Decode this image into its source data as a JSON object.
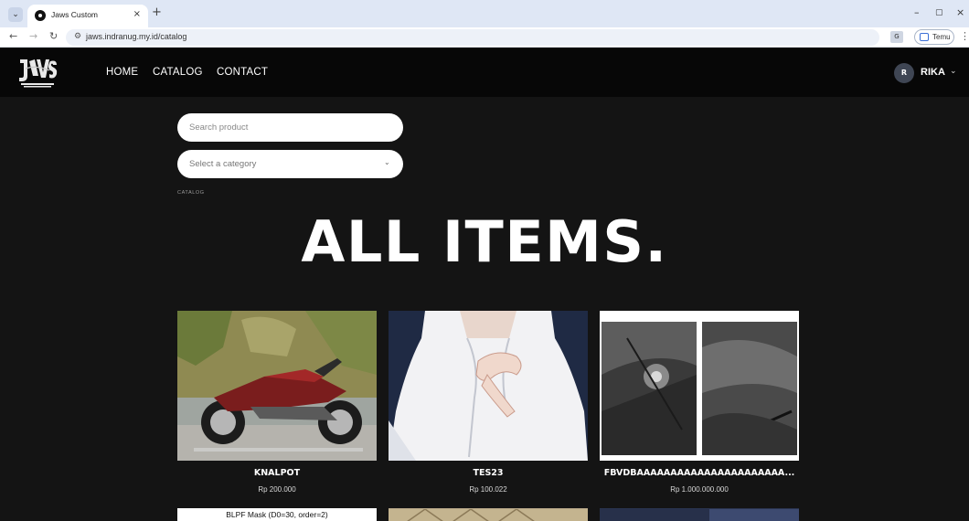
{
  "browser": {
    "tab_title": "Jaws Custom",
    "tab_close": "×",
    "new_tab": "+",
    "tab_list": "⌄",
    "url": "jaws.indranug.my.id/catalog",
    "profile_label": "Temu",
    "window_minimize": "–",
    "window_restore": "▢",
    "window_close": "×",
    "back": "←",
    "forward": "→",
    "reload": "↻",
    "site_info": "⚙",
    "translate": "G",
    "menu": "⋮"
  },
  "header": {
    "logo_text": "JAWS",
    "nav": [
      "HOME",
      "CATALOG",
      "CONTACT"
    ],
    "user_initial": "R",
    "user_name": "RIKA",
    "user_chevron": "⌄"
  },
  "filters": {
    "search_placeholder": "Search product",
    "category_label": "Select a category",
    "category_chevron": "⌄"
  },
  "breadcrumb": "CATALOG",
  "heading": "ALL ITEMS.",
  "products": [
    {
      "name": "KNALPOT",
      "price": "Rp 200.000",
      "image": "motorcycle-photo"
    },
    {
      "name": "TES23",
      "price": "Rp 100.022",
      "image": "anime-illustration"
    },
    {
      "name": "FBVDBAAAAAAAAAAAAAAAAAAAAAA...",
      "price": "Rp 1.000.000.000",
      "image": "grayscale-comic-panels"
    }
  ],
  "second_row": [
    {
      "caption": "BLPF Mask (D0=30, order=2)"
    },
    {
      "caption": ""
    },
    {
      "caption": ""
    }
  ],
  "colors": {
    "page_bg": "#141414",
    "header_bg": "#070707",
    "tabbar_bg": "#dfe7f5",
    "text": "#ffffff"
  }
}
